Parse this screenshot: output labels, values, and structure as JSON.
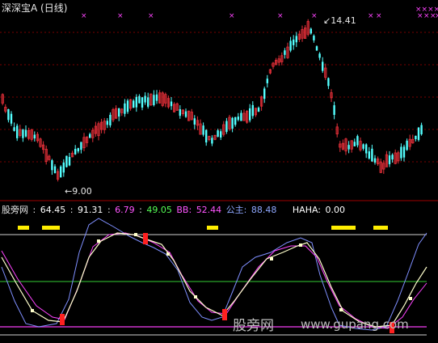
{
  "window": {
    "stock_name": "深深宝A",
    "period": "(日线)"
  },
  "price_panel": {
    "high_label": "14.41",
    "low_label": "9.00",
    "up_color": "#e8303a",
    "down_color": "#54ffff",
    "ma_color": "#ffffff"
  },
  "indicator": {
    "name": "股旁网",
    "v1": "64.45",
    "v2": "91.31",
    "v3": "6.79",
    "v4": "49.05",
    "bb_label": "BB:",
    "bb_value": "52.44",
    "gz_label": "公主:",
    "gz_value": "88.48",
    "haha_label": "HAHA:",
    "haha_value": "0.00",
    "colors": {
      "v3": "#ff55ff",
      "v4": "#55ff55",
      "bb": "#ff55ff",
      "gz": "#8fa8ff",
      "line_white": "#ffffcc",
      "line_magenta": "#ff44ff",
      "line_blue": "#7f8fff",
      "level_green": "#33cc33",
      "level_magenta": "#cc33cc",
      "signal_yellow": "#ffee00",
      "signal_red": "#ff2020"
    }
  },
  "watermark": {
    "cn": "股旁网",
    "url": "www.gupang.com"
  }
}
